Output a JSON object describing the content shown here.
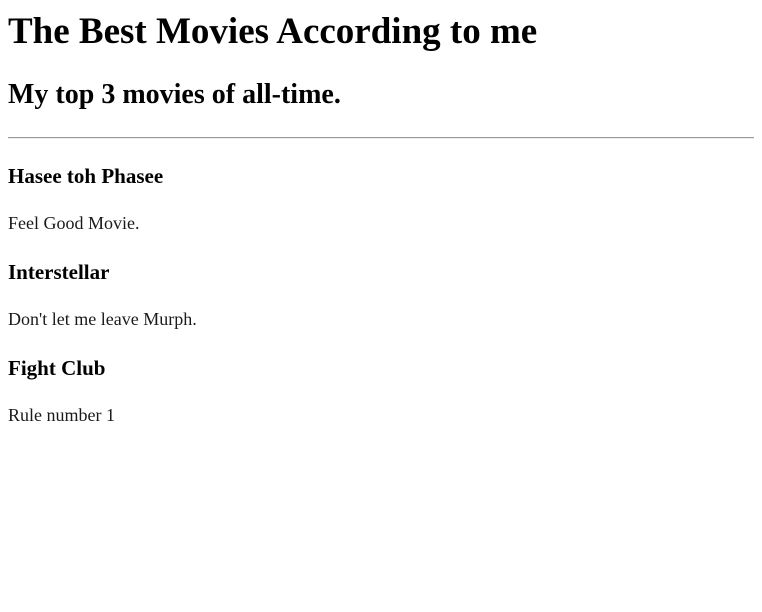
{
  "header": {
    "title": "The Best Movies According to me",
    "subtitle": "My top 3 movies of all-time."
  },
  "movies": [
    {
      "name": "Hasee toh Phasee",
      "description": "Feel Good Movie."
    },
    {
      "name": "Interstellar",
      "description": "Don't let me leave Murph."
    },
    {
      "name": "Fight Club",
      "description": "Rule number 1"
    }
  ]
}
